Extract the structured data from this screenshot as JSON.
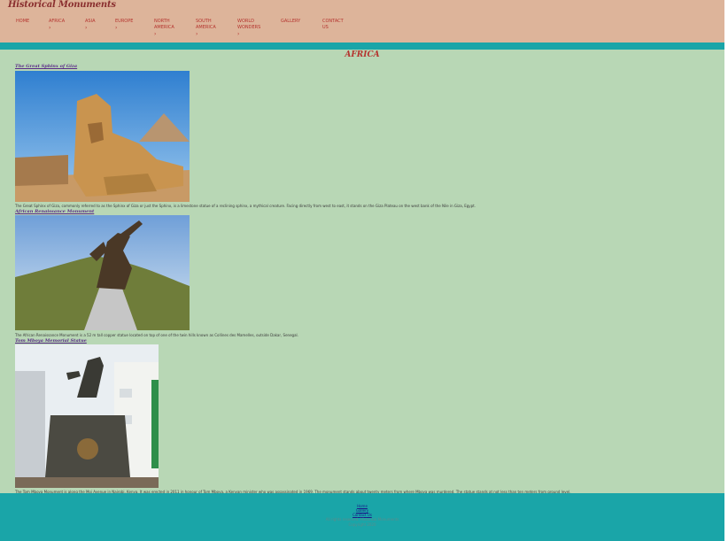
{
  "site": {
    "title": "Historical Monuments"
  },
  "nav": {
    "items": [
      {
        "label": "HOME",
        "chevron": ""
      },
      {
        "label": "AFRICA",
        "chevron": "›"
      },
      {
        "label": "ASIA",
        "chevron": "›"
      },
      {
        "label": "EUROPE",
        "chevron": "›"
      },
      {
        "label": "NORTH AMERICA",
        "chevron": "›"
      },
      {
        "label": "SOUTH AMERICA",
        "chevron": "›"
      },
      {
        "label": "WORLD WONDERS",
        "chevron": "›"
      },
      {
        "label": "GALLERY",
        "chevron": ""
      },
      {
        "label": "CONTACT US",
        "chevron": ""
      }
    ]
  },
  "main": {
    "heading": "AFRICA",
    "monuments": [
      {
        "title": "The Great Sphinx of Giza",
        "image": "sphinx-photo",
        "description": "The Great Sphinx of Giza, commonly referred to as the Sphinx of Giza or just the Sphinx, is a limestone statue of a reclining sphinx, a mythical creature. Facing directly from west to east, it stands on the Giza Plateau on the west bank of the Nile in Giza, Egypt."
      },
      {
        "title": "African Renaissance Monument",
        "image": "renaissance-monument-photo",
        "description": "The African Renaissance Monument is a 52 m tall copper statue located on top of one of the twin hills known as Collines des Mamelles, outside Dakar, Senegal."
      },
      {
        "title": "Tom Mboya Memorial Statue",
        "image": "tom-mboya-statue-photo",
        "description": "The Tom Mboya Monument is along the Moi Avenue in Nairobi, Kenya. It was erected in 2011 in honour of Tom Mboya, a Kenyan minister who was assassinated in 1969. The monument stands about twenty meters from where Mboya was murdered. The statue stands at not less than ten meters from ground level."
      }
    ]
  },
  "footer": {
    "links": [
      "Home",
      "Gallery",
      "Contact Us"
    ],
    "lines": [
      "All rights reserved. Historical Monuments",
      "Copyright 2020"
    ]
  },
  "colors": {
    "header_bg": "#ddb49a",
    "teal": "#1aa5a8",
    "content_bg": "#b8d7b5",
    "accent_red": "#b5332e"
  }
}
